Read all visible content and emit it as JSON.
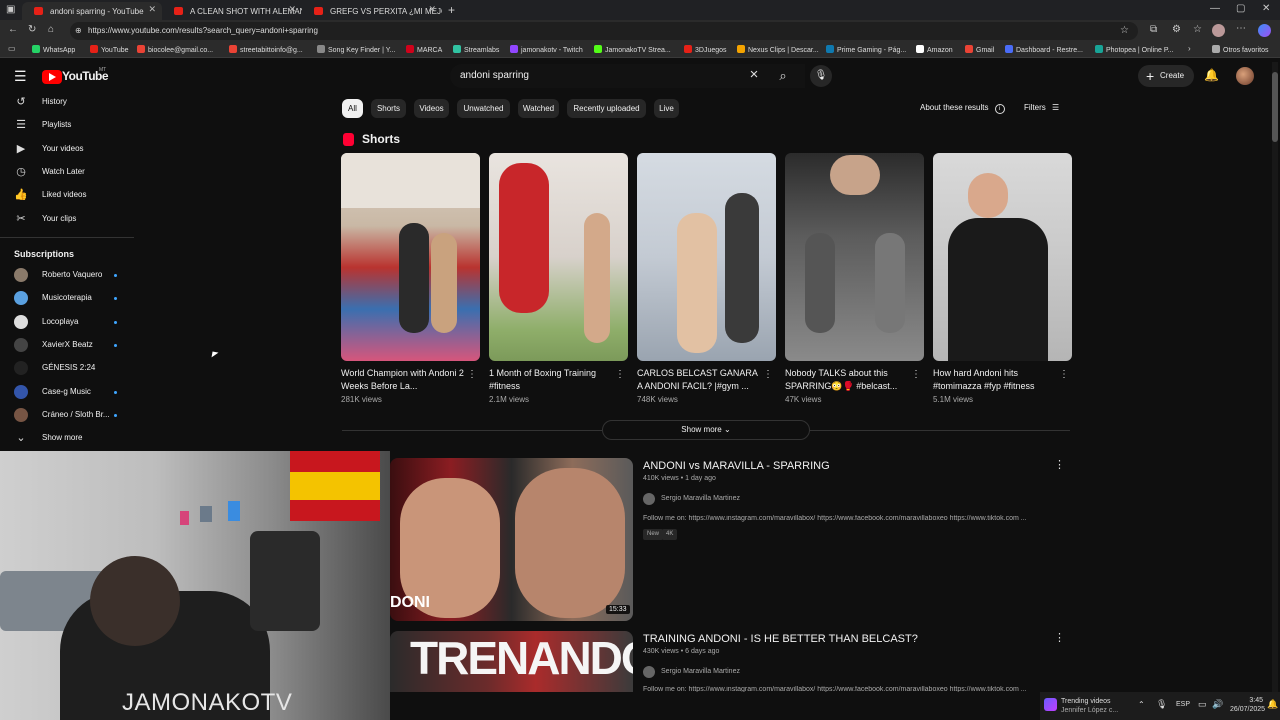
{
  "browser": {
    "tabs": [
      {
        "label": "andoni sparring - YouTube"
      },
      {
        "label": "A CLEAN SHOT WITH ALEMAN - ..."
      },
      {
        "label": "GREFG VS PERXITA ¿MI MEJOR S..."
      }
    ],
    "url": "https://www.youtube.com/results?search_query=andoni+sparring",
    "bookmarks": [
      {
        "label": "WhatsApp",
        "color": "#25d366"
      },
      {
        "label": "YouTube",
        "color": "#e62117"
      },
      {
        "label": "biocolee@gmail.co...",
        "color": "#ea4335"
      },
      {
        "label": "streetabittoinfo@g...",
        "color": "#ea4335"
      },
      {
        "label": "Song Key Finder | Y...",
        "color": "#888888"
      },
      {
        "label": "MARCA",
        "color": "#d0021b"
      },
      {
        "label": "Streamlabs",
        "color": "#31c3a2"
      },
      {
        "label": "jamonakotv - Twitch",
        "color": "#9146ff"
      },
      {
        "label": "JamonakoTV Strea...",
        "color": "#53fc18"
      },
      {
        "label": "3DJuegos",
        "color": "#e62117"
      },
      {
        "label": "Nexus Clips | Descar...",
        "color": "#f4a300"
      },
      {
        "label": "Prime Gaming - Pág...",
        "color": "#0f79af"
      },
      {
        "label": "Amazon",
        "color": "#ffffff"
      },
      {
        "label": "Gmail",
        "color": "#ea4335"
      },
      {
        "label": "Dashboard - Restre...",
        "color": "#4a6cf7"
      },
      {
        "label": "Photopea | Online P...",
        "color": "#18a497"
      },
      {
        "label": "Otros favoritos",
        "color": "#aaaaaa"
      }
    ]
  },
  "youtube": {
    "logo": "YouTube",
    "logo_region": "MT",
    "search_value": "andoni sparring",
    "create_label": "Create",
    "sidebar": {
      "items": [
        {
          "label": "History",
          "icon": "history-icon",
          "glyph": "↺"
        },
        {
          "label": "Playlists",
          "icon": "playlist-icon",
          "glyph": "☰"
        },
        {
          "label": "Your videos",
          "icon": "your-videos-icon",
          "glyph": "▶"
        },
        {
          "label": "Watch Later",
          "icon": "clock-icon",
          "glyph": "◷"
        },
        {
          "label": "Liked videos",
          "icon": "thumb-up-icon",
          "glyph": "👍"
        },
        {
          "label": "Your clips",
          "icon": "scissors-icon",
          "glyph": "✂"
        }
      ],
      "subscriptions_heading": "Subscriptions",
      "subscriptions": [
        {
          "label": "Roberto Vaquero",
          "color": "#8a7a6a",
          "live": true
        },
        {
          "label": "Musicoterapia",
          "color": "#5aa0e0",
          "live": true
        },
        {
          "label": "Locoplaya",
          "color": "#dddddd",
          "live": true
        },
        {
          "label": "XavierX Beatz",
          "color": "#444444",
          "live": true
        },
        {
          "label": "GÉNESIS 2:24",
          "color": "#222222",
          "live": false
        },
        {
          "label": "Case-g Music",
          "color": "#3355aa",
          "live": true
        },
        {
          "label": "Cráneo / Sloth Br...",
          "color": "#775544",
          "live": true
        }
      ],
      "show_more": "Show more"
    },
    "chips": [
      "All",
      "Shorts",
      "Videos",
      "Unwatched",
      "Watched",
      "Recently uploaded",
      "Live"
    ],
    "about_results": "About these results",
    "filters": "Filters",
    "shorts_heading": "Shorts",
    "shorts": [
      {
        "title": "World Champion with Andoni 2 Weeks Before La...",
        "views": "281K views",
        "c1": "#b9332f",
        "c2": "#d8cfc4"
      },
      {
        "title": "1 Month of Boxing Training #fitness",
        "views": "2.1M views",
        "c1": "#c8262a",
        "c2": "#8fae6a"
      },
      {
        "title": "CARLOS BELCAST GANARA A ANDONI FACIL? |#gym ...",
        "views": "748K views",
        "c1": "#9aa4b0",
        "c2": "#e8eaec"
      },
      {
        "title": "Nobody TALKS about this SPARRING😳🥊 #belcast...",
        "views": "47K views",
        "c1": "#6f6f6f",
        "c2": "#bdbdbd"
      },
      {
        "title": "How hard Andoni hits #tomimazza #fyp #fitness",
        "views": "5.1M views",
        "c1": "#1a1a1a",
        "c2": "#c9c9c9"
      }
    ],
    "show_more_shorts": "Show more",
    "videos": [
      {
        "title": "ANDONI vs MARAVILLA - SPARRING",
        "meta": "410K views • 1 day ago",
        "channel": "Sergio Maravilla Martinez",
        "desc": "Follow me on: https://www.instagram.com/maravillabox/ https://www.facebook.com/maravillaboxeo https://www.tiktok.com ...",
        "badges": [
          "New",
          "4K"
        ],
        "duration": "15:33",
        "thumb_text": "DONI"
      },
      {
        "title": "TRAINING ANDONI - IS HE BETTER THAN BELCAST?",
        "meta": "430K views • 6 days ago",
        "channel": "Sergio Maravilla Martinez",
        "desc": "Follow me on: https://www.instagram.com/maravillabox/ https://www.facebook.com/maravillaboxeo https://www.tiktok.com ...",
        "thumb_text": "TRENANDO"
      }
    ]
  },
  "webcam": {
    "overlay": "JAMONAKOTV"
  },
  "taskbar": {
    "trending_title": "Trending videos",
    "trending_sub": "Jennifer López c...",
    "lang": "ESP",
    "time": "3:45",
    "date": "26/07/2025"
  }
}
